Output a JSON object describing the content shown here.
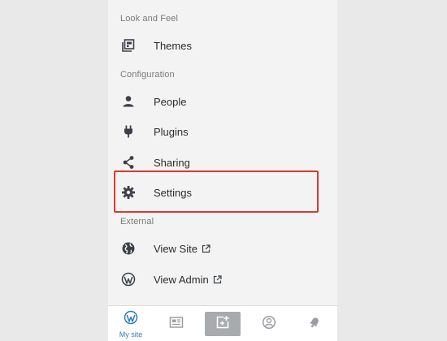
{
  "sections": {
    "look_and_feel": "Look and Feel",
    "configuration": "Configuration",
    "external": "External"
  },
  "menu": {
    "themes": "Themes",
    "people": "People",
    "plugins": "Plugins",
    "sharing": "Sharing",
    "settings": "Settings",
    "view_site": "View Site",
    "view_admin": "View Admin"
  },
  "icons": {
    "themes": "themes-icon",
    "people": "person-icon",
    "plugins": "plug-icon",
    "sharing": "share-icon",
    "settings": "gear-icon",
    "view_site": "globe-icon",
    "view_admin": "wordpress-icon",
    "external": "external-link-icon"
  },
  "tabbar": {
    "my_site": "My site",
    "active_color": "#2e7dbd"
  },
  "colors": {
    "highlight": "#d93a2b",
    "icon": "#3c4148"
  }
}
